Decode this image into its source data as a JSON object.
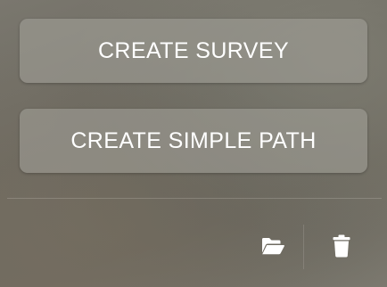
{
  "actions": {
    "create_survey_label": "CREATE SURVEY",
    "create_simple_path_label": "CREATE SIMPLE PATH"
  },
  "toolbar": {
    "icons": [
      "open-folder-icon",
      "trash-icon"
    ]
  },
  "colors": {
    "button_bg": "#a09e96",
    "text": "#ffffff",
    "icon": "#ffffff"
  }
}
